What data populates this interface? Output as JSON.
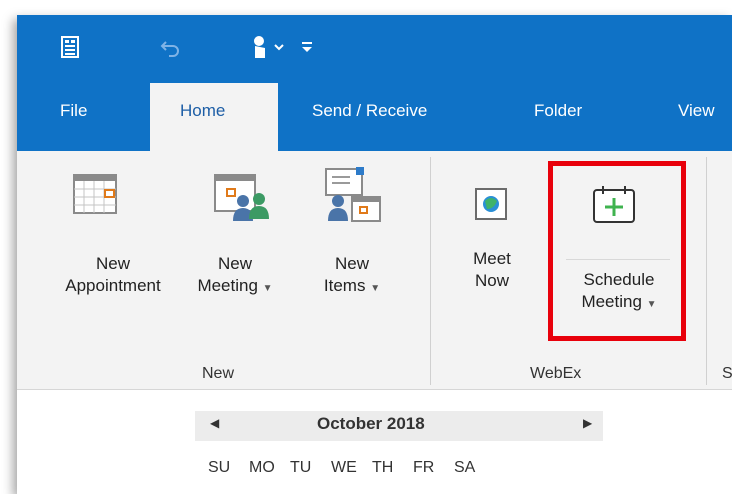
{
  "quick_access": {
    "app_icon": "outlook-send-receive-icon",
    "undo_icon": "undo-icon",
    "touch_icon": "touch-mode-icon",
    "customize_icon": "customize-qat-icon"
  },
  "tabs": [
    {
      "label": "File"
    },
    {
      "label": "Home"
    },
    {
      "label": "Send / Receive"
    },
    {
      "label": "Folder"
    },
    {
      "label": "View"
    }
  ],
  "ribbon": {
    "new_group": {
      "label": "New",
      "buttons": [
        {
          "line1": "New",
          "line2": "Appointment"
        },
        {
          "line1": "New",
          "line2": "Meeting"
        },
        {
          "line1": "New",
          "line2": "Items"
        }
      ]
    },
    "webex_group": {
      "label": "WebEx",
      "buttons": [
        {
          "line1": "Meet",
          "line2": "Now"
        },
        {
          "line1": "Schedule",
          "line2": "Meeting"
        }
      ]
    },
    "partial_group_label": "S"
  },
  "calendar": {
    "month": "October 2018",
    "days": [
      "SU",
      "MO",
      "TU",
      "WE",
      "TH",
      "FR",
      "SA"
    ]
  },
  "colors": {
    "accent": "#0f72c6",
    "highlight": "#e8000b",
    "active_tab_text": "#1d5ea6"
  }
}
